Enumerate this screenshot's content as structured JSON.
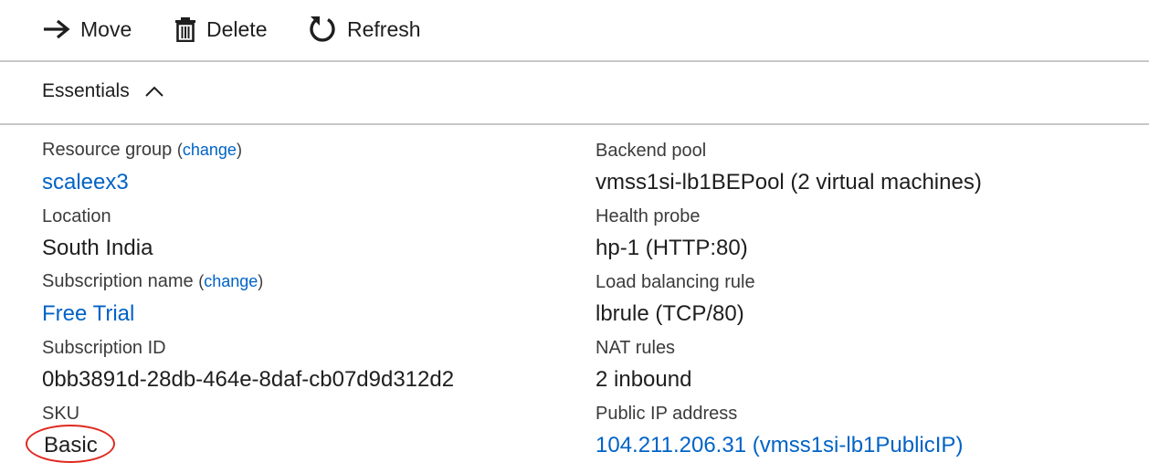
{
  "toolbar": {
    "move_label": "Move",
    "delete_label": "Delete",
    "refresh_label": "Refresh"
  },
  "essentials": {
    "label": "Essentials"
  },
  "left": {
    "resource_group": {
      "label": "Resource group",
      "change": "change",
      "open_paren": "(",
      "close_paren": ")",
      "value": "scaleex3"
    },
    "location": {
      "label": "Location",
      "value": "South India"
    },
    "subscription_name": {
      "label": "Subscription name",
      "change": "change",
      "open_paren": "(",
      "close_paren": ")",
      "value": "Free Trial"
    },
    "subscription_id": {
      "label": "Subscription ID",
      "value": "0bb3891d-28db-464e-8daf-cb07d9d312d2"
    },
    "sku": {
      "label": "SKU",
      "value": "Basic"
    }
  },
  "right": {
    "backend_pool": {
      "label": "Backend pool",
      "value": "vmss1si-lb1BEPool (2 virtual machines)"
    },
    "health_probe": {
      "label": "Health probe",
      "value": "hp-1 (HTTP:80)"
    },
    "lb_rule": {
      "label": "Load balancing rule",
      "value": "lbrule (TCP/80)"
    },
    "nat_rules": {
      "label": "NAT rules",
      "value": "2 inbound"
    },
    "public_ip": {
      "label": "Public IP address",
      "value": "104.211.206.31 (vmss1si-lb1PublicIP)"
    }
  },
  "colors": {
    "link": "#0063c6",
    "highlight_circle": "#e02a1f",
    "divider": "#c8c8c8"
  },
  "icons": {
    "move": "arrow-right-icon",
    "delete": "trash-icon",
    "refresh": "refresh-icon",
    "collapse": "chevron-up-icon"
  }
}
